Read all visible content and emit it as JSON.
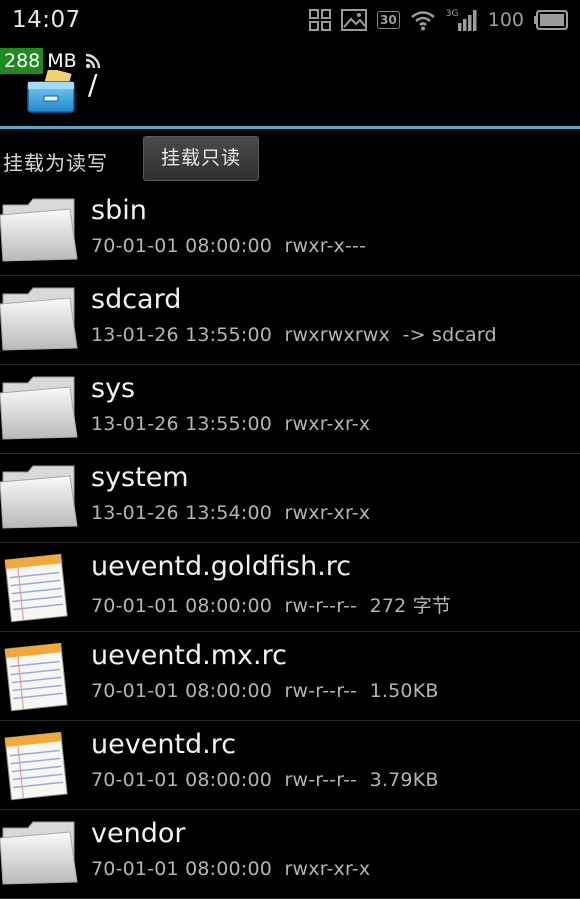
{
  "status_bar": {
    "time": "14:07",
    "calendar_badge": "30",
    "network_type": "3G",
    "battery_level": "100",
    "icons": [
      "grid-icon",
      "image-icon",
      "calendar-icon",
      "wifi-icon",
      "signal-icon",
      "battery-icon"
    ]
  },
  "header": {
    "memory_value": "288",
    "memory_unit": "MB",
    "path": "/"
  },
  "mount_bar": {
    "mount_read_write": "挂载为读写",
    "mount_read_only": "挂载只读"
  },
  "files": [
    {
      "name": "sbin",
      "type": "folder",
      "meta": "70-01-01 08:00:00  rwxr-x---"
    },
    {
      "name": "sdcard",
      "type": "folder",
      "meta": "13-01-26 13:55:00  rwxrwxrwx  -> sdcard"
    },
    {
      "name": "sys",
      "type": "folder",
      "meta": "13-01-26 13:55:00  rwxr-xr-x"
    },
    {
      "name": "system",
      "type": "folder",
      "meta": "13-01-26 13:54:00  rwxr-xr-x"
    },
    {
      "name": "ueventd.goldfish.rc",
      "type": "file",
      "meta": "70-01-01 08:00:00  rw-r--r--  272 字节"
    },
    {
      "name": "ueventd.mx.rc",
      "type": "file",
      "meta": "70-01-01 08:00:00  rw-r--r--  1.50KB"
    },
    {
      "name": "ueventd.rc",
      "type": "file",
      "meta": "70-01-01 08:00:00  rw-r--r--  3.79KB"
    },
    {
      "name": "vendor",
      "type": "folder",
      "meta": "70-01-01 08:00:00  rwxr-xr-x"
    }
  ],
  "colors": {
    "accent_rule": "#5aa8c8",
    "memory_badge": "#1f8a22",
    "background": "#000000"
  }
}
